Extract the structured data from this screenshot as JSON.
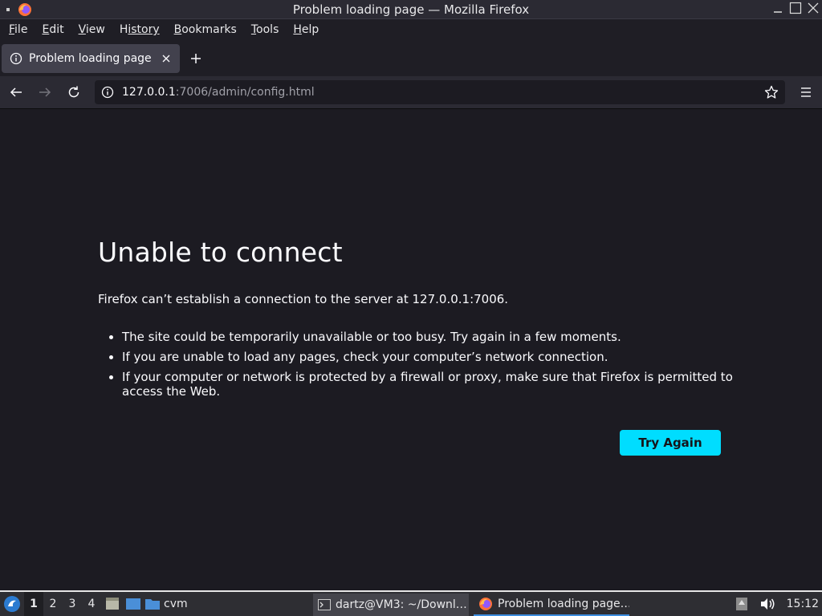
{
  "window": {
    "title": "Problem loading page — Mozilla Firefox"
  },
  "menubar": {
    "items": [
      {
        "first": "F",
        "rest": "ile"
      },
      {
        "first": "E",
        "rest": "dit"
      },
      {
        "first": "V",
        "rest": "iew"
      },
      {
        "first": "H",
        "rest": "istory"
      },
      {
        "first": "B",
        "rest": "ookmarks"
      },
      {
        "first": "T",
        "rest": "ools"
      },
      {
        "first": "H",
        "rest": "elp"
      }
    ]
  },
  "tabs": [
    {
      "title": "Problem loading page",
      "icon": "info-icon"
    }
  ],
  "urlbar": {
    "host": "127.0.0.1",
    "rest": ":7006/admin/config.html"
  },
  "error": {
    "title": "Unable to connect",
    "description": "Firefox can’t establish a connection to the server at 127.0.0.1:7006.",
    "bullets": [
      "The site could be temporarily unavailable or too busy. Try again in a few moments.",
      "If you are unable to load any pages, check your computer’s network connection.",
      "If your computer or network is protected by a firewall or proxy, make sure that Firefox is permitted to access the Web."
    ],
    "button_label": "Try Again"
  },
  "taskbar": {
    "workspaces": [
      "1",
      "2",
      "3",
      "4"
    ],
    "folder_label": "cvm",
    "tasks": [
      {
        "label": "dartz@VM3: ~/Downl…",
        "icon": "terminal-icon"
      },
      {
        "label": "Problem loading page…",
        "icon": "firefox-icon"
      }
    ],
    "clock": "15:12"
  },
  "colors": {
    "accent_button": "#00ddff",
    "content_bg": "#1c1b22",
    "toolbar_bg": "#2b2a33"
  }
}
